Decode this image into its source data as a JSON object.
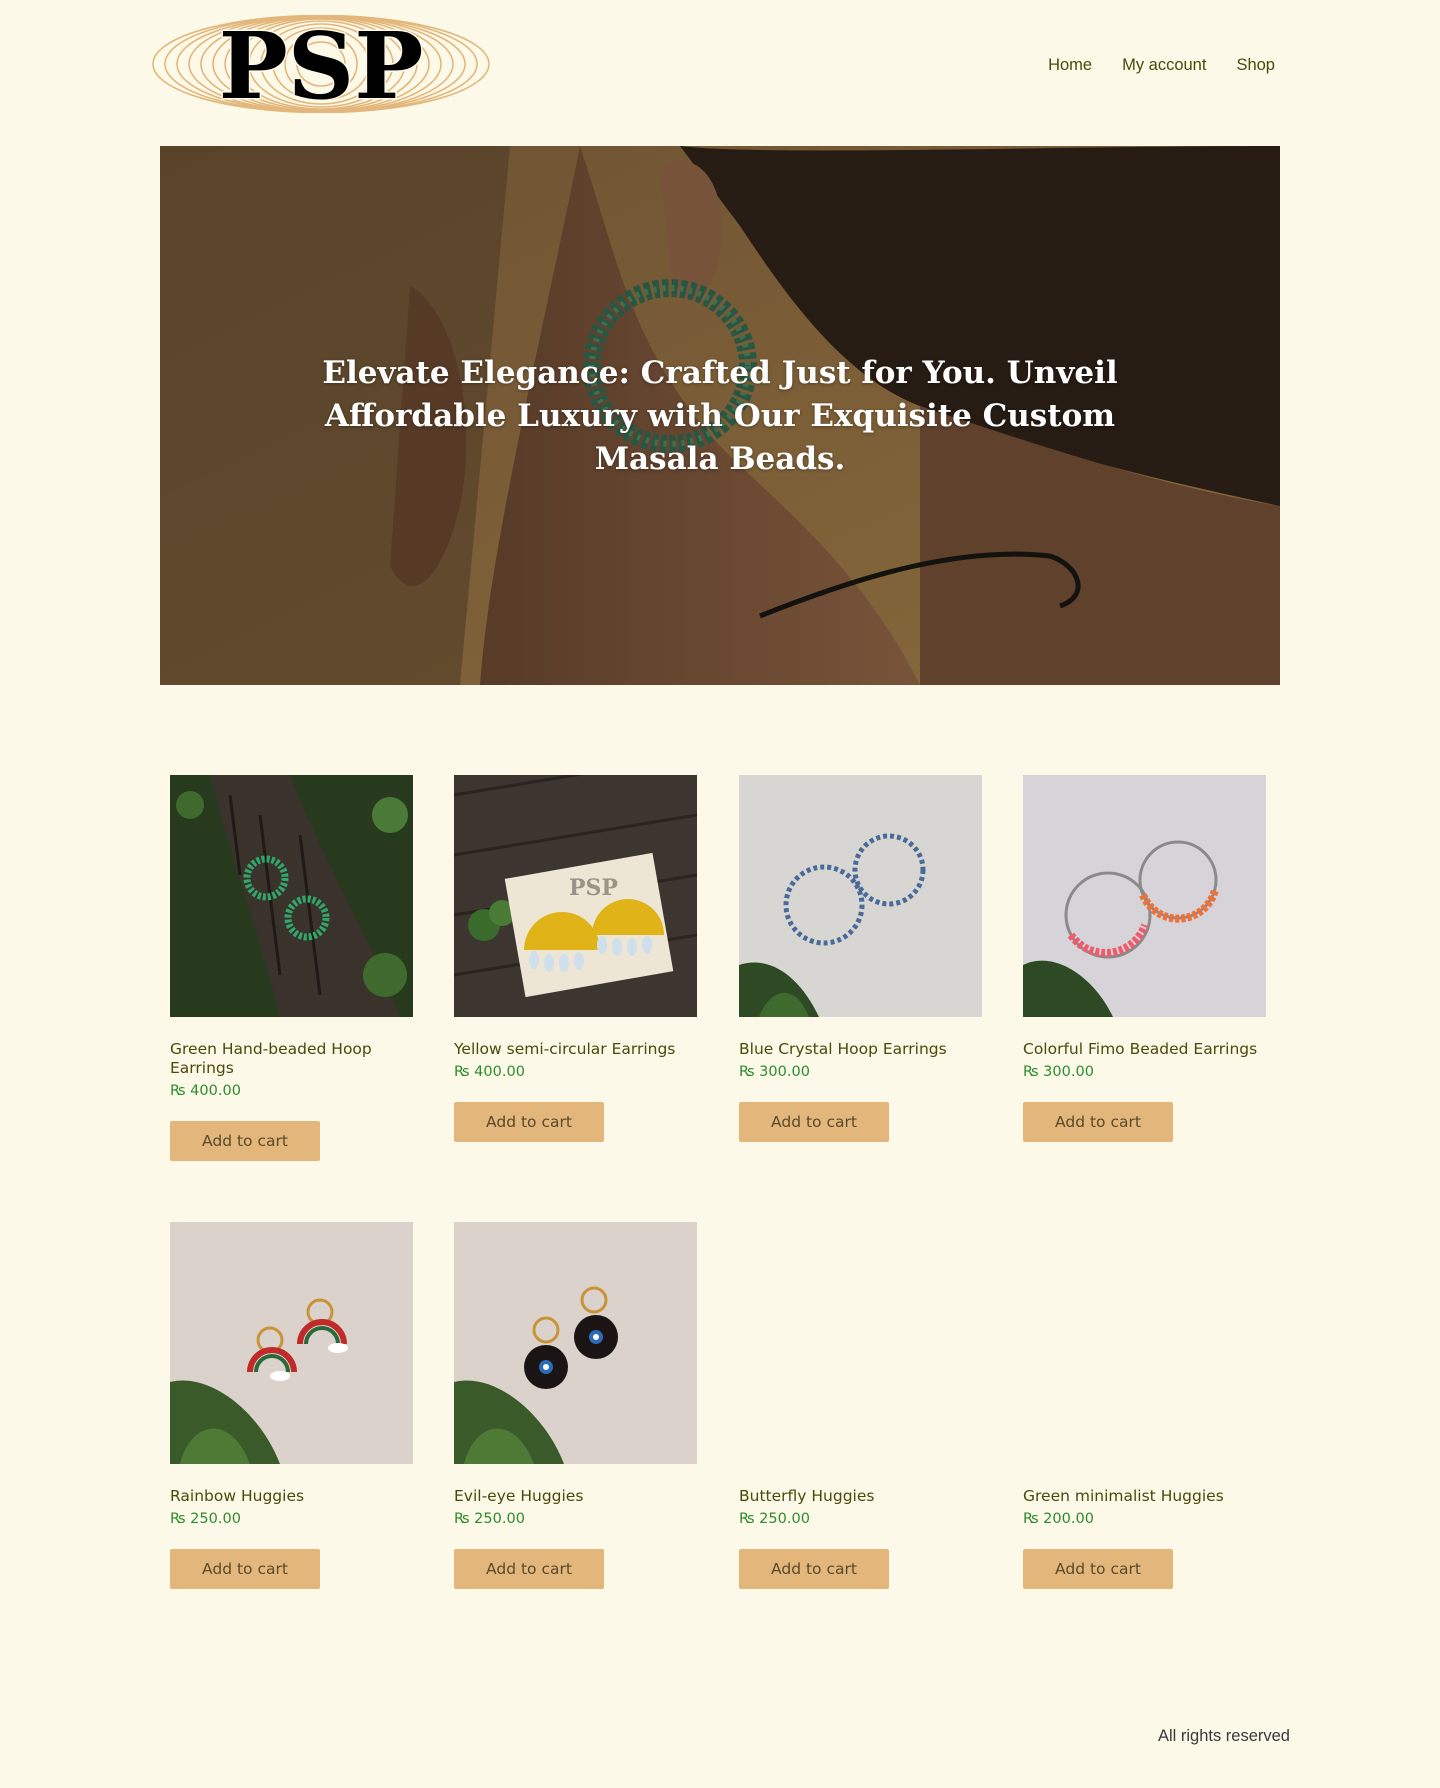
{
  "header": {
    "logo_text": "PSP",
    "nav": [
      {
        "label": "Home"
      },
      {
        "label": "My account"
      },
      {
        "label": "Shop"
      }
    ]
  },
  "hero": {
    "heading": "Elevate Elegance: Crafted Just for You. Unveil Affordable Luxury with Our Exquisite Custom Masala Beads."
  },
  "products": [
    {
      "title": "Green Hand-beaded Hoop Earrings",
      "price": "₨ 400.00",
      "button": "Add to cart",
      "image": "green-hoop-earrings"
    },
    {
      "title": "Yellow semi-circular Earrings",
      "price": "₨ 400.00",
      "button": "Add to cart",
      "image": "yellow-semicircular-earrings"
    },
    {
      "title": "Blue Crystal Hoop Earrings",
      "price": "₨ 300.00",
      "button": "Add to cart",
      "image": "blue-crystal-hoops"
    },
    {
      "title": "Colorful Fimo Beaded Earrings",
      "price": "₨ 300.00",
      "button": "Add to cart",
      "image": "fimo-beaded-hoops"
    },
    {
      "title": "Rainbow Huggies",
      "price": "₨ 250.00",
      "button": "Add to cart",
      "image": "rainbow-huggies"
    },
    {
      "title": "Evil-eye Huggies",
      "price": "₨ 250.00",
      "button": "Add to cart",
      "image": "evil-eye-huggies"
    },
    {
      "title": "Butterfly Huggies",
      "price": "₨ 250.00",
      "button": "Add to cart",
      "image": ""
    },
    {
      "title": "Green minimalist Huggies",
      "price": "₨ 200.00",
      "button": "Add to cart",
      "image": ""
    }
  ],
  "footer": {
    "text": "All rights reserved"
  },
  "colors": {
    "background": "#fcf9e8",
    "button": "#e3b77c",
    "price": "#2e8b2e",
    "logo_rings": "#e3b77c"
  }
}
